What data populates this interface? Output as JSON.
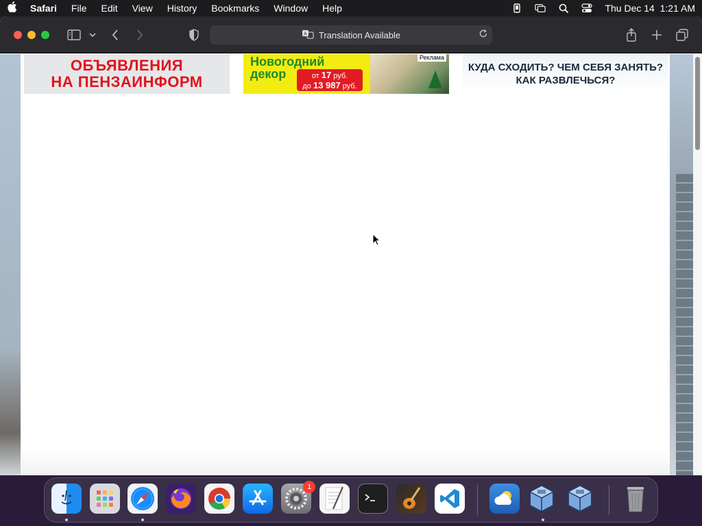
{
  "menubar": {
    "app_name": "Safari",
    "items": [
      "File",
      "Edit",
      "View",
      "History",
      "Bookmarks",
      "Window",
      "Help"
    ],
    "clock": "Thu Dec 14  1:21 AM"
  },
  "toolbar": {
    "address_text": "Translation Available"
  },
  "banners": {
    "ads": {
      "line1": "ОБЪЯВЛЕНИЯ",
      "line2": "НА ПЕНЗАИНФОРМ"
    },
    "decor": {
      "title_line1": "Новогодний",
      "title_line2": "декор",
      "price_from_prefix": "от",
      "price_from_value": "17",
      "price_from_unit": "руб.",
      "price_to_prefix": "до",
      "price_to_value": "13 987",
      "price_to_unit": "руб.",
      "ad_label": "Реклама"
    },
    "where": {
      "line1": "КУДА СХОДИТЬ? ЧЕМ СЕБЯ ЗАНЯТЬ?",
      "line2": "КАК РАЗВЛЕЧЬСЯ?"
    }
  },
  "dock": {
    "apps": [
      {
        "name": "Finder",
        "icon": "finder-icon",
        "color": "#1e90ff",
        "running": true
      },
      {
        "name": "Launchpad",
        "icon": "launchpad-icon",
        "color": "#d9d9e0",
        "running": false
      },
      {
        "name": "Safari",
        "icon": "safari-icon",
        "color": "#1a8cff",
        "running": true
      },
      {
        "name": "Firefox",
        "icon": "firefox-icon",
        "color": "#ff7a1a",
        "running": false
      },
      {
        "name": "Chrome",
        "icon": "chrome-icon",
        "color": "#ffffff",
        "running": false
      },
      {
        "name": "App Store",
        "icon": "app-store-icon",
        "color": "#1c8cf5",
        "running": false
      },
      {
        "name": "System Settings",
        "icon": "settings-icon",
        "color": "#8e8e93",
        "running": false,
        "badge": "1"
      },
      {
        "name": "TextEdit",
        "icon": "textedit-icon",
        "color": "#f4f4f4",
        "running": false
      },
      {
        "name": "Terminal",
        "icon": "terminal-icon",
        "color": "#1e1e1e",
        "running": false
      },
      {
        "name": "GarageBand",
        "icon": "garageband-icon",
        "color": "#3a2a22",
        "running": false
      },
      {
        "name": "VS Code",
        "icon": "vscode-icon",
        "color": "#ffffff",
        "running": false
      },
      {
        "name": "Weather",
        "icon": "weather-icon",
        "color": "#2f7bd6",
        "running": false
      },
      {
        "name": "VirtualBox",
        "icon": "virtualbox-icon",
        "color": "#4a6fa5",
        "running": true
      },
      {
        "name": "VirtualBox VM",
        "icon": "virtualbox-vm-icon",
        "color": "#4a6fa5",
        "running": false
      },
      {
        "name": "Trash",
        "icon": "trash-icon",
        "color": "#9a9aa0",
        "running": false
      }
    ]
  }
}
